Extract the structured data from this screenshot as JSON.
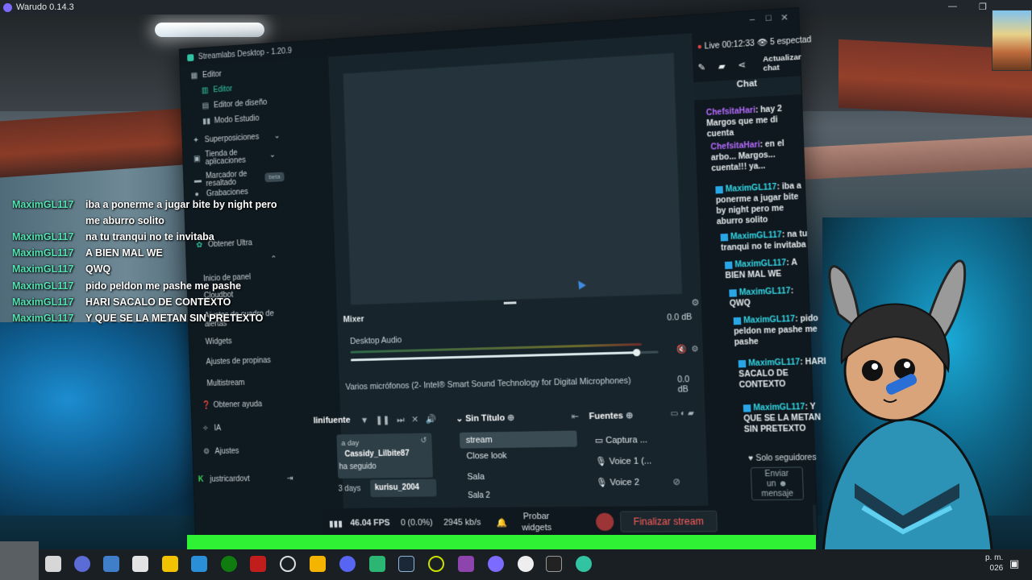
{
  "app": {
    "title": "Warudo 0.14.3"
  },
  "streamlabs": {
    "title": "Streamlabs Desktop - 1.20.9",
    "nav": {
      "editor_group": "Editor",
      "editor": "Editor",
      "layout_editor": "Editor de diseño",
      "studio_mode": "Modo Estudio",
      "overlays": "Superposiciones",
      "app_store_l1": "Tienda de",
      "app_store_l2": "aplicaciones",
      "highlighter_l1": "Marcador de",
      "highlighter_l2": "resaltado",
      "highlighter_badge": "beta",
      "recordings": "Grabaciones",
      "ultra": "Obtener Ultra",
      "dashboard": "Inicio de panel",
      "cloudbot": "Cloudbot",
      "alertbox_l1": "Ajustes de cuadro de",
      "alertbox_l2": "alertas",
      "widgets": "Widgets",
      "tip_settings": "Ajustes de propinas",
      "multistream": "Multistream",
      "help": "Obtener ayuda",
      "ai": "IA",
      "settings": "Ajustes",
      "user": "justricardovt"
    },
    "mixer": {
      "title": "Mixer",
      "ch1_name": "Desktop Audio",
      "ch1_db": "0.0 dB",
      "ch1_level": 0.93,
      "ch2_name": "Varios micrófonos (2- Intel® Smart Sound Technology for Digital Microphones)",
      "ch2_db": "0.0 dB"
    },
    "activity": {
      "title": "linifuente",
      "items": [
        {
          "time": "a day",
          "user": "Cassidy_Lilbite87",
          "action": "ha seguido"
        },
        {
          "time": "3 days",
          "user": "kurisu_2004"
        }
      ]
    },
    "scenes": {
      "title": "Sin Título",
      "items": [
        "stream",
        "Close look",
        "Sala",
        "Sala 2"
      ]
    },
    "sources": {
      "title": "Fuentes",
      "items": [
        "Captura ...",
        "Voice 1 (...",
        "Voice 2"
      ]
    },
    "status": {
      "fps": "46.04 FPS",
      "dropped": "0 (0.0%)",
      "bitrate": "2945 kb/s",
      "test_widgets_l1": "Probar",
      "test_widgets_l2": "widgets",
      "end_stream": "Finalizar stream"
    },
    "live": {
      "label": "Live",
      "time": "00:12:33",
      "viewers": "5 espectad",
      "refresh_l1": "Actualizar",
      "refresh_l2": "chat"
    },
    "chat": {
      "title": "Chat",
      "messages": [
        {
          "user": "ChefsitaHari",
          "text": "hay 2 Margos que me di cuenta"
        },
        {
          "user": "ChefsitaHari",
          "text": "en el arbo... Margos... cuenta!!! ya..."
        },
        {
          "user": "MaximGL117",
          "text": "iba a ponerme a jugar bite by night pero me aburro solito"
        },
        {
          "user": "MaximGL117",
          "text": "na tu tranqui no te invitaba"
        },
        {
          "user": "MaximGL117",
          "text": "A BIEN MAL WE"
        },
        {
          "user": "MaximGL117",
          "text": "QWQ"
        },
        {
          "user": "MaximGL117",
          "text": "pido peldon me pashe me pashe"
        },
        {
          "user": "MaximGL117",
          "text": "HARI SACALO DE CONTEXTO"
        },
        {
          "user": "MaximGL117",
          "text": "Y QUE SE LA METAN SIN PRETEXTO"
        }
      ],
      "followers_only": "Solo seguidores",
      "send_l1": "Enviar",
      "send_l2": "un",
      "send_l3": "mensaje"
    }
  },
  "overlay_chat": [
    {
      "user": "MaximGL117",
      "text": "iba a ponerme a jugar bite by night pero"
    },
    {
      "user": "",
      "text": "me aburro solito"
    },
    {
      "user": "MaximGL117",
      "text": "na tu tranqui no te invitaba"
    },
    {
      "user": "MaximGL117",
      "text": "A BIEN MAL WE"
    },
    {
      "user": "MaximGL117",
      "text": "QWQ"
    },
    {
      "user": "MaximGL117",
      "text": "pido peldon me pashe me pashe"
    },
    {
      "user": "MaximGL117",
      "text": "HARI SACALO DE CONTEXTO"
    },
    {
      "user": "MaximGL117",
      "text": "Y QUE SE LA METAN SIN PRETEXTO"
    }
  ],
  "taskbar": {
    "clock_l1": "p. m.",
    "clock_l2": "026"
  }
}
